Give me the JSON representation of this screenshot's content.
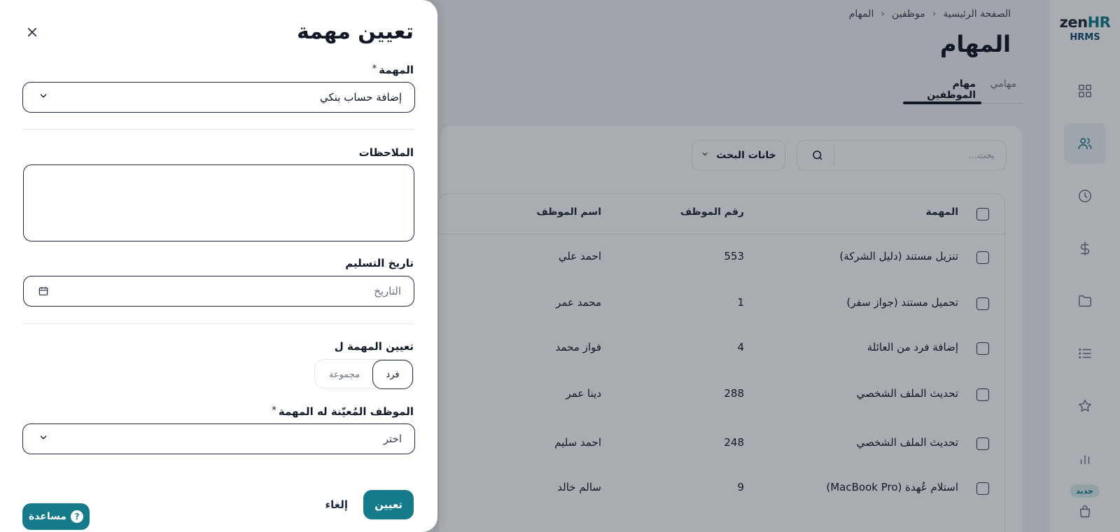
{
  "brand": {
    "logo_main_a": "zen",
    "logo_main_b": "HR",
    "logo_sub": "HRMS",
    "accent": "#157a8a"
  },
  "sidebar": {
    "items": [
      {
        "icon": "grid-icon"
      },
      {
        "icon": "users-icon",
        "active": true
      },
      {
        "icon": "clock-icon"
      },
      {
        "icon": "dollar-icon"
      },
      {
        "icon": "folder-icon"
      },
      {
        "icon": "list-icon"
      },
      {
        "icon": "star-icon"
      },
      {
        "icon": "chart-icon"
      },
      {
        "icon": "bag-icon"
      }
    ],
    "new_badge": "جديد"
  },
  "breadcrumb": {
    "home": "الصفحة الرئيسية",
    "employees": "موظفين",
    "current": "المهام"
  },
  "page": {
    "title": "المهام",
    "tabs": {
      "mine": "مهامي",
      "employees": "مهام الموظفين"
    },
    "search": {
      "placeholder": "بحث..."
    },
    "search_fields_label": "خانات البحث"
  },
  "table": {
    "headers": {
      "task": "المهمة",
      "number": "رقم الموظف",
      "name": "اسم الموظف"
    },
    "rows": [
      {
        "task": "تنزيل مستند (دليل الشركة)",
        "number": "553",
        "name": "احمد علي"
      },
      {
        "task": "تحميل مستند (جواز سفر)",
        "number": "1",
        "name": "محمد عمر"
      },
      {
        "task": "إضافة فرد من العائلة",
        "number": "4",
        "name": "فواز محمد"
      },
      {
        "task": "تحديث الملف الشخصي",
        "number": "288",
        "name": "دينا عمر"
      },
      {
        "task": "تحديث الملف الشخصي",
        "number": "248",
        "name": "احمد سليم"
      },
      {
        "task": "استلام عُهدة (MacBook Pro)",
        "number": "9",
        "name": "سالم خالد"
      }
    ]
  },
  "drawer": {
    "title": "تعيين مهمة",
    "task_label": "المهمة",
    "task_value": "إضافة حساب بنكي",
    "notes_label": "الملاحظات",
    "delivery_label": "تاريخ التسليم",
    "date_placeholder": "التاريخ",
    "assign_to_label": "تعيين المهمة ل",
    "assign_options": {
      "individual": "فرد",
      "group": "مجموعة"
    },
    "employee_label": "الموظف المُعيّنة له المهمة",
    "employee_placeholder": "اختر",
    "required_mark": "*",
    "assign_button": "تعيين",
    "cancel_button": "إلغاء"
  },
  "help": {
    "label": "مساعدة",
    "mark": "?"
  }
}
